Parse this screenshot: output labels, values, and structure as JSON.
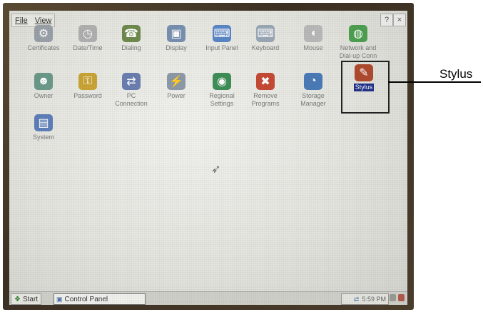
{
  "menu": {
    "file": "File",
    "view": "View"
  },
  "window_buttons": {
    "help": "?",
    "close": "×"
  },
  "icons": [
    {
      "label": "Certificates",
      "name": "certificates-icon",
      "glyph": "⚙",
      "color": "#9aa0a8"
    },
    {
      "label": "Date/Time",
      "name": "date-time-icon",
      "glyph": "◷",
      "color": "#b0b0b0"
    },
    {
      "label": "Dialing",
      "name": "dialing-icon",
      "glyph": "☎",
      "color": "#6f8a4c"
    },
    {
      "label": "Display",
      "name": "display-icon",
      "glyph": "▣",
      "color": "#7890b0"
    },
    {
      "label": "Input Panel",
      "name": "input-panel-icon",
      "glyph": "⌨",
      "color": "#5a86c6"
    },
    {
      "label": "Keyboard",
      "name": "keyboard-icon",
      "glyph": "⌨",
      "color": "#9aa7b5"
    },
    {
      "label": "Mouse",
      "name": "mouse-icon",
      "glyph": "◖",
      "color": "#b9b9b9"
    },
    {
      "label": "Network and\nDial-up Conn",
      "name": "network-icon",
      "glyph": "◍",
      "color": "#4d9f4f"
    },
    {
      "label": "Owner",
      "name": "owner-icon",
      "glyph": "☻",
      "color": "#6b9a8a"
    },
    {
      "label": "Password",
      "name": "password-icon",
      "glyph": "⚿",
      "color": "#c9a436"
    },
    {
      "label": "PC\nConnection",
      "name": "pc-connection-icon",
      "glyph": "⇄",
      "color": "#6a7fb0"
    },
    {
      "label": "Power",
      "name": "power-icon",
      "glyph": "⚡",
      "color": "#8d9aa8"
    },
    {
      "label": "Regional\nSettings",
      "name": "regional-settings-icon",
      "glyph": "◉",
      "color": "#3f8e57"
    },
    {
      "label": "Remove\nPrograms",
      "name": "remove-programs-icon",
      "glyph": "✖",
      "color": "#c54a35"
    },
    {
      "label": "Storage\nManager",
      "name": "storage-manager-icon",
      "glyph": "◔",
      "color": "#4a7bb8"
    },
    {
      "label": "Stylus",
      "name": "stylus-icon",
      "glyph": "✎",
      "color": "#b04a2e"
    },
    {
      "label": "System",
      "name": "system-icon",
      "glyph": "▤",
      "color": "#5e7fb8"
    }
  ],
  "taskbar": {
    "start": "Start",
    "task": "Control Panel",
    "clock": "5:59 PM"
  },
  "callout": "Stylus"
}
